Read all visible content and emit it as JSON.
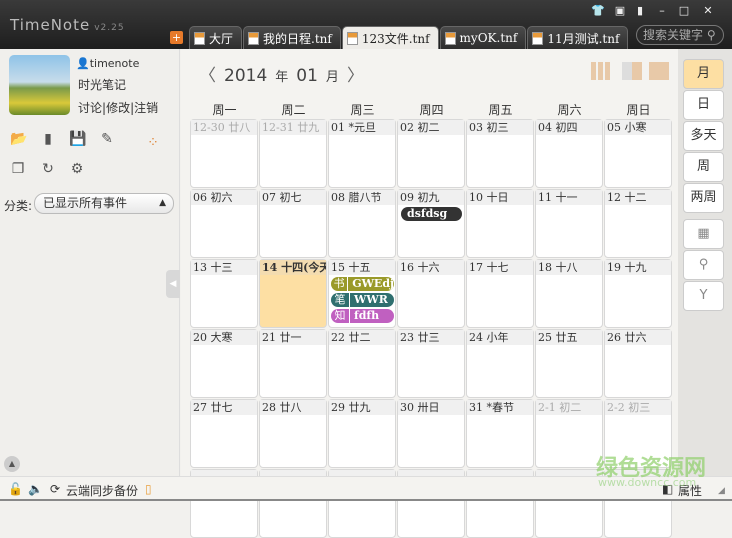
{
  "app": {
    "name": "TimeNote",
    "version": "v2.25"
  },
  "tabs": [
    {
      "label": "大厅"
    },
    {
      "label": "我的日程.tnf"
    },
    {
      "label": "123文件.tnf",
      "active": true
    },
    {
      "label": "myOK.tnf"
    },
    {
      "label": "11月测试.tnf"
    }
  ],
  "search": {
    "placeholder": "搜索关键字"
  },
  "user": {
    "name": "timenote",
    "nickname": "时光笔记",
    "links": [
      "讨论",
      "修改",
      "注销"
    ]
  },
  "category": {
    "label": "分类:",
    "selected": "已显示所有事件"
  },
  "calendar": {
    "year": "2014",
    "year_unit": "年",
    "month": "01",
    "month_unit": "月",
    "weekdays": [
      "周一",
      "周二",
      "周三",
      "周四",
      "周五",
      "周六",
      "周日"
    ],
    "days": [
      {
        "label": "12-30 廿八",
        "other": true
      },
      {
        "label": "12-31 廿九",
        "other": true
      },
      {
        "label": "01 *元旦"
      },
      {
        "label": "02 初二"
      },
      {
        "label": "03 初三"
      },
      {
        "label": "04 初四"
      },
      {
        "label": "05 小寒"
      },
      {
        "label": "06 初六"
      },
      {
        "label": "07 初七"
      },
      {
        "label": "08 腊八节"
      },
      {
        "label": "09 初九",
        "events": [
          {
            "name": "dsfdsg",
            "color": "#333333"
          }
        ]
      },
      {
        "label": "10 十日"
      },
      {
        "label": "11 十一"
      },
      {
        "label": "12 十二"
      },
      {
        "label": "13 十三"
      },
      {
        "label": "14 十四(今天)",
        "today": true
      },
      {
        "label": "15 十五",
        "events": [
          {
            "tag": "书",
            "name": "GWEdj",
            "color": "#9a9a2a"
          },
          {
            "tag": "笔",
            "name": "WWR",
            "color": "#2f6f6f"
          },
          {
            "tag": "知",
            "name": "fdfh",
            "color": "#c060c0"
          }
        ]
      },
      {
        "label": "16 十六"
      },
      {
        "label": "17 十七"
      },
      {
        "label": "18 十八"
      },
      {
        "label": "19 十九"
      },
      {
        "label": "20 大寒"
      },
      {
        "label": "21 廿一"
      },
      {
        "label": "22 廿二"
      },
      {
        "label": "23 廿三"
      },
      {
        "label": "24 小年"
      },
      {
        "label": "25 廿五"
      },
      {
        "label": "26 廿六"
      },
      {
        "label": "27 廿七"
      },
      {
        "label": "28 廿八"
      },
      {
        "label": "29 廿九"
      },
      {
        "label": "30 卅日"
      },
      {
        "label": "31 *春节"
      },
      {
        "label": "2-1 初二",
        "other": true
      },
      {
        "label": "2-2 初三",
        "other": true
      },
      {
        "label": ""
      },
      {
        "label": ""
      },
      {
        "label": ""
      },
      {
        "label": ""
      },
      {
        "label": ""
      },
      {
        "label": ""
      },
      {
        "label": ""
      }
    ]
  },
  "views": [
    "月",
    "日",
    "多天",
    "周",
    "两周"
  ],
  "status": {
    "sync": "云端同步备份",
    "properties": "属性"
  },
  "watermark": {
    "text": "绿色资源网",
    "url": "www.downcc.com"
  },
  "colors": {
    "today": "#fddfa3",
    "active_view": "#fddfa3"
  }
}
